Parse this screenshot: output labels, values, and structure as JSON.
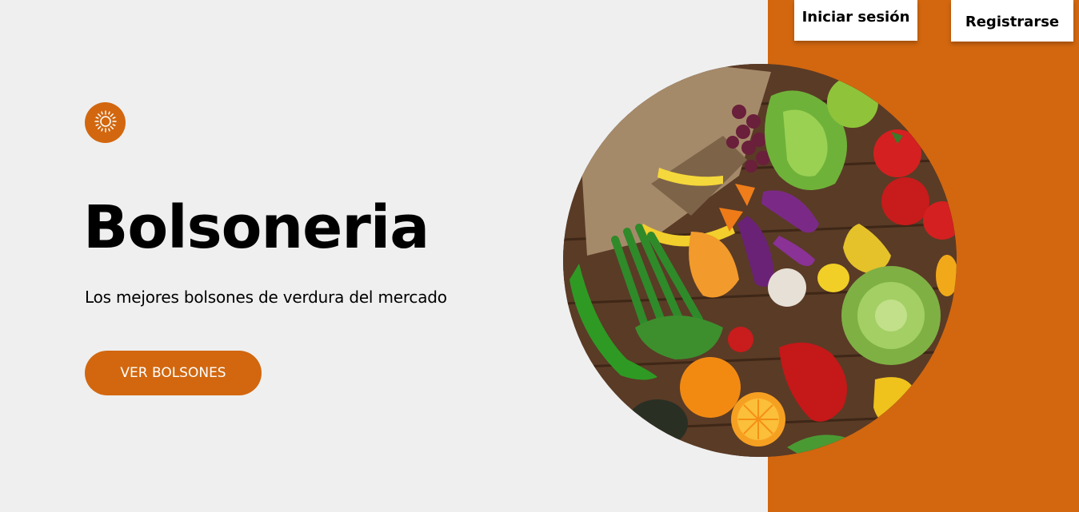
{
  "header": {
    "login_label": "Iniciar sesión",
    "register_label": "Registrarse"
  },
  "hero": {
    "icon": "sun-icon",
    "title": "Bolsoneria",
    "tagline": "Los mejores bolsones de verdura del mercado",
    "cta_label": "VER BOLSONES",
    "image": "vegetables-produce-photo"
  },
  "colors": {
    "accent": "#d2670f",
    "background": "#efefef",
    "button_bg": "#ffffff"
  }
}
